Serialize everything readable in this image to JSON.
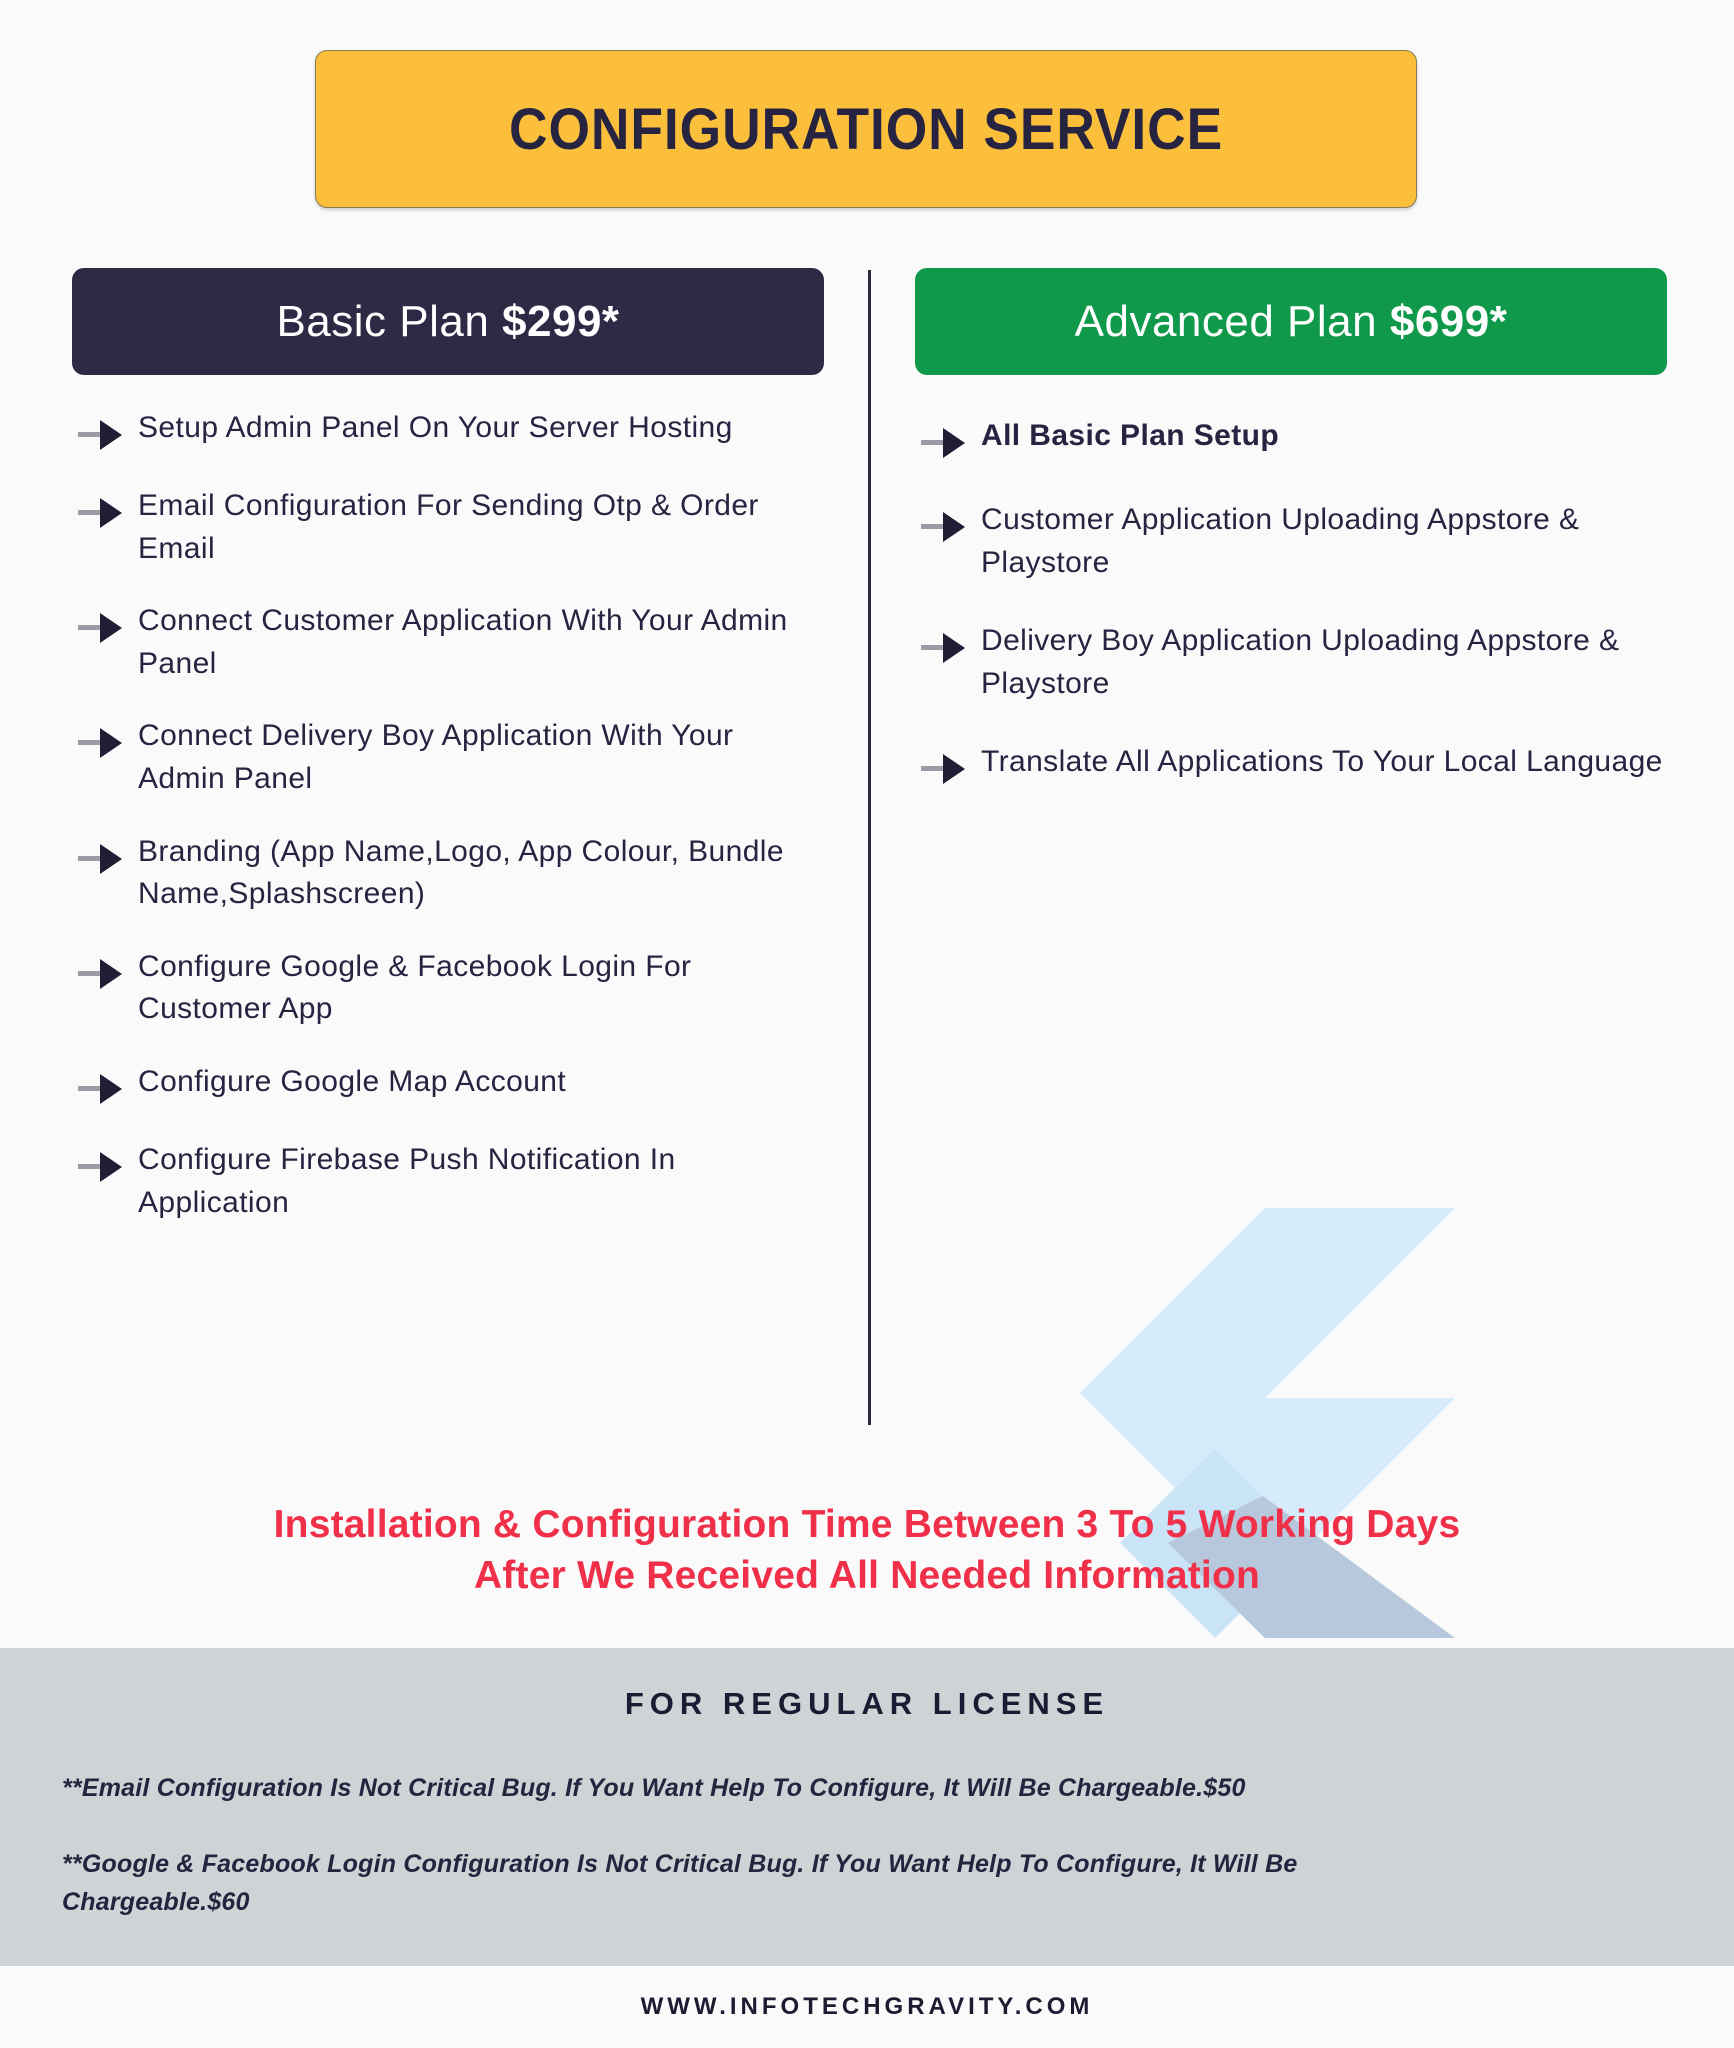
{
  "header": {
    "title": "CONFIGURATION SERVICE",
    "banner_color": "#fbbf3c",
    "title_color": "#262440"
  },
  "plans": {
    "basic": {
      "header_label_plain": "Basic Plan ",
      "header_label_price": "$299*",
      "header_color": "#2e2a45",
      "features": [
        "Setup Admin Panel On Your Server Hosting",
        "Email Configuration For Sending Otp & Order Email",
        "Connect Customer Application With Your Admin Panel",
        "Connect Delivery Boy Application With Your Admin Panel",
        "Branding (App Name,Logo, App Colour, Bundle Name,Splashscreen)",
        "Configure Google & Facebook Login For Customer App",
        "Configure Google Map Account",
        "Configure Firebase Push Notification In Application"
      ]
    },
    "advanced": {
      "header_label_plain": "Advanced Plan ",
      "header_label_price": "$699*",
      "header_color": "#10994a",
      "features": [
        "All Basic Plan Setup",
        "Customer Application Uploading Appstore & Playstore",
        "Delivery Boy Application Uploading Appstore & Playstore",
        "Translate All Applications To Your Local Language"
      ],
      "bold_features": [
        true,
        false,
        false,
        false
      ],
      "logo": "flutter-logo"
    }
  },
  "notice": {
    "line1": "Installation & Configuration Time Between 3 To 5  Working Days",
    "line2": "After We Received All Needed Information",
    "color": "#f03049"
  },
  "license": {
    "title": "FOR REGULAR LICENSE",
    "background": "#cfd3d6",
    "note1_text": "**Email Configuration Is Not Critical Bug. If You Want Help To Configure, It Will Be Chargeable.",
    "note1_price": "$50",
    "note2_text": "**Google & Facebook Login Configuration Is Not Critical Bug. If You Want Help To Configure, It Will Be Chargeable.",
    "note2_price": "$60"
  },
  "footer": {
    "url": "WWW.INFOTECHGRAVITY.COM"
  }
}
